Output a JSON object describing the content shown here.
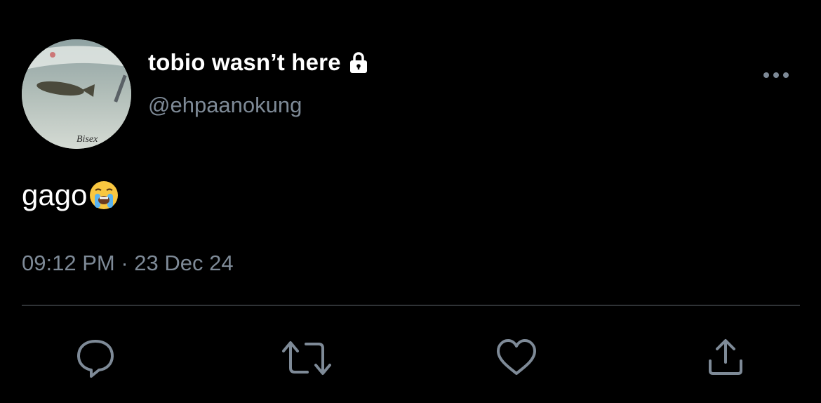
{
  "author": {
    "display_name": "tobio wasn’t here",
    "handle": "@ehpaanokung",
    "avatar_caption": "Bisex",
    "protected_icon": "lock-icon"
  },
  "tweet": {
    "text": "gago",
    "emoji": "loudly-crying-face",
    "time": "09:12 PM",
    "separator": "·",
    "date": "23 Dec 24"
  },
  "actions": [
    {
      "name": "reply",
      "icon": "speech-bubble-icon"
    },
    {
      "name": "retweet",
      "icon": "retweet-icon"
    },
    {
      "name": "like",
      "icon": "heart-icon"
    },
    {
      "name": "share",
      "icon": "share-icon"
    }
  ],
  "colors": {
    "background": "#000000",
    "text_primary": "#ffffff",
    "text_secondary": "#7e8a97",
    "divider": "#2f3336",
    "icon": "#7e8a97"
  }
}
